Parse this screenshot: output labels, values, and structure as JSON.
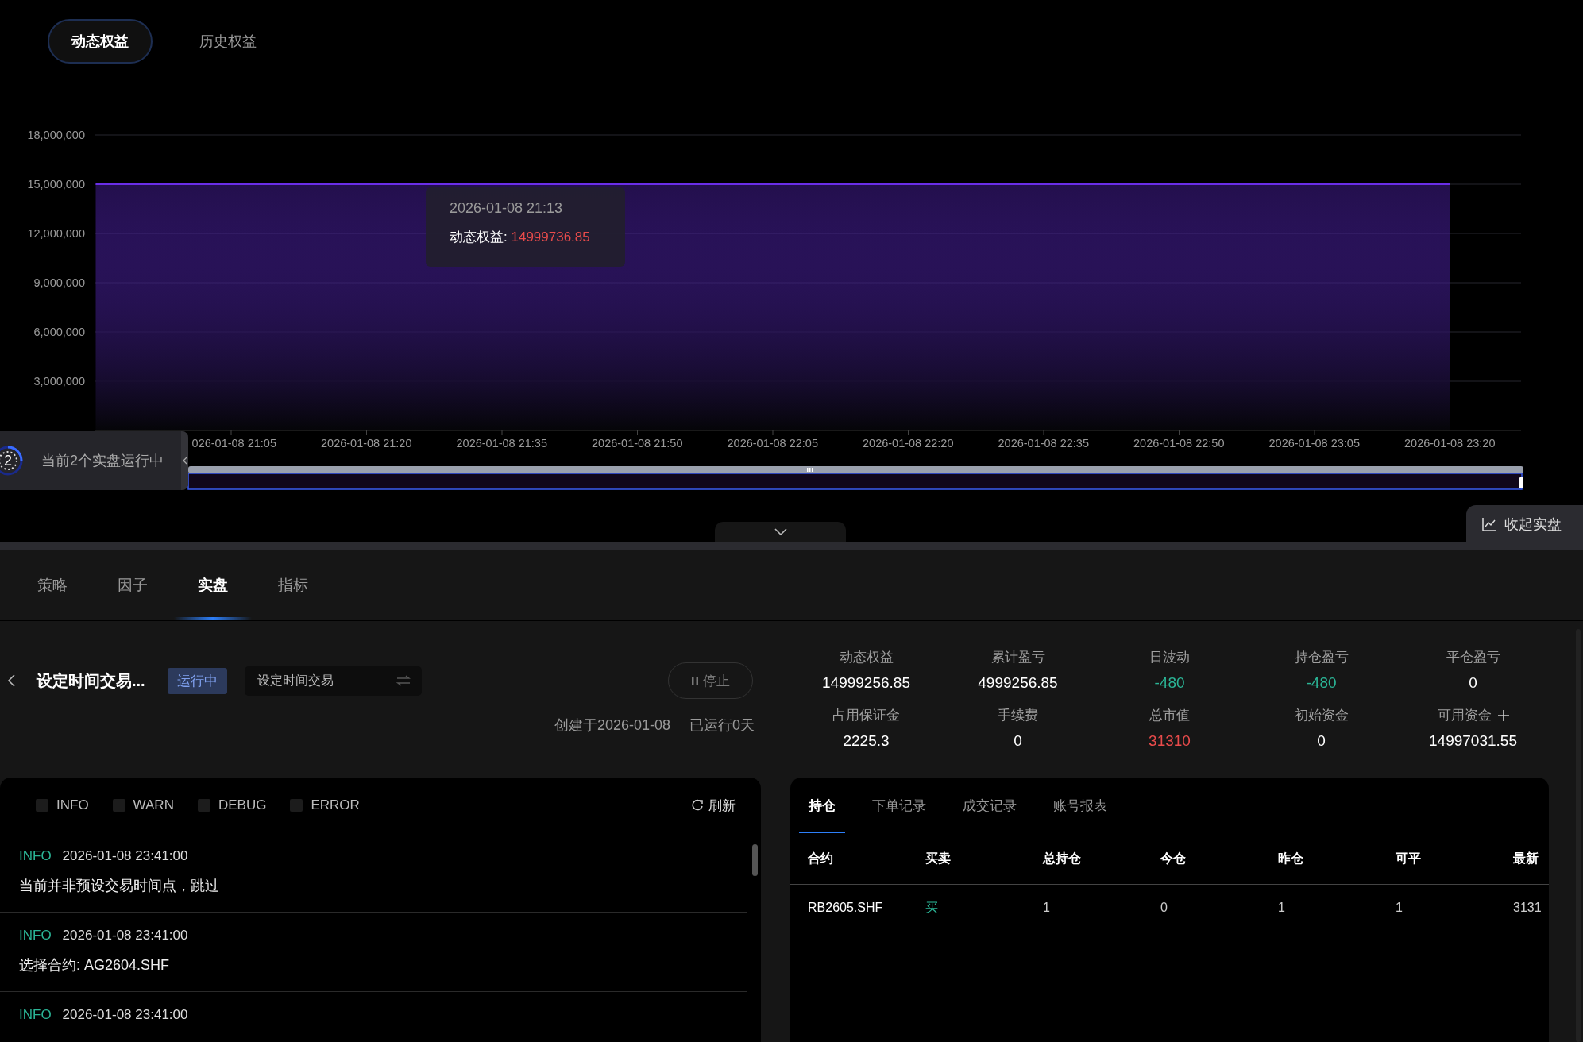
{
  "equity_tabs": [
    {
      "label": "动态权益",
      "selected": true
    },
    {
      "label": "历史权益",
      "selected": false
    }
  ],
  "equity_chart": {
    "chart_data": {
      "type": "area",
      "grid": true,
      "categories": [
        null,
        "026-01-08 21:05",
        "2026-01-08 21:20",
        "2026-01-08 21:35",
        "2026-01-08 21:50",
        "2026-01-08 22:05",
        "2026-01-08 22:20",
        "2026-01-08 22:35",
        "2026-01-08 22:50",
        "2026-01-08 23:05",
        "2026-01-08 23:20"
      ],
      "series": [
        {
          "color": "#6a2ee8",
          "values": [
            15000000,
            15000000,
            15000000,
            15000000,
            15000000,
            15000000,
            15000000,
            15000000,
            15000000,
            15000000,
            15000000
          ]
        }
      ],
      "ylim": [
        0,
        18000000
      ],
      "yticks": [
        {
          "value": 3000000,
          "label": "3,000,000"
        },
        {
          "value": 6000000,
          "label": "6,000,000"
        },
        {
          "value": 9000000,
          "label": "9,000,000"
        },
        {
          "value": 12000000,
          "label": "12,000,000"
        },
        {
          "value": 15000000,
          "label": "15,000,000"
        },
        {
          "value": 18000000,
          "label": "18,000,000"
        }
      ]
    },
    "tooltip": {
      "time": "2026-01-08 21:13",
      "label": "动态权益:",
      "value": "14999736.85"
    }
  },
  "running_notice": {
    "count": "2",
    "text": "当前2个实盘运行中"
  },
  "collapse_button": {
    "label": "收起实盘"
  },
  "module_tabs": [
    {
      "label": "策略",
      "selected": false
    },
    {
      "label": "因子",
      "selected": false
    },
    {
      "label": "实盘",
      "selected": true
    },
    {
      "label": "指标",
      "selected": false
    }
  ],
  "strategy": {
    "title": "设定时间交易...",
    "status": "运行中",
    "selector": "设定时间交易",
    "stop_button": "停止",
    "created": "创建于2026-01-08",
    "running_days": "已运行0天"
  },
  "stats": [
    {
      "label": "动态权益",
      "value": "14999256.85",
      "color": "#ffffff",
      "addable": false
    },
    {
      "label": "累计盈亏",
      "value": "4999256.85",
      "color": "#ffffff",
      "addable": false
    },
    {
      "label": "日波动",
      "value": "-480",
      "color": "#2bb596",
      "addable": false
    },
    {
      "label": "持仓盈亏",
      "value": "-480",
      "color": "#2bb596",
      "addable": false
    },
    {
      "label": "平仓盈亏",
      "value": "0",
      "color": "#ffffff",
      "addable": false
    },
    {
      "label": "占用保证金",
      "value": "2225.3",
      "color": "#ffffff",
      "addable": false
    },
    {
      "label": "手续费",
      "value": "0",
      "color": "#ffffff",
      "addable": false
    },
    {
      "label": "总市值",
      "value": "31310",
      "color": "#e84b4b",
      "addable": false
    },
    {
      "label": "初始资金",
      "value": "0",
      "color": "#ffffff",
      "addable": false
    },
    {
      "label": "可用资金",
      "value": "14997031.55",
      "color": "#ffffff",
      "addable": true
    }
  ],
  "log_filters": [
    {
      "label": "INFO",
      "checked": false
    },
    {
      "label": "WARN",
      "checked": false
    },
    {
      "label": "DEBUG",
      "checked": false
    },
    {
      "label": "ERROR",
      "checked": false
    }
  ],
  "refresh_button": "刷新",
  "logs": [
    {
      "level": "INFO",
      "color": "#2bb596",
      "time": "2026-01-08 23:41:00",
      "message": "当前并非预设交易时间点，跳过"
    },
    {
      "level": "INFO",
      "color": "#2bb596",
      "time": "2026-01-08 23:41:00",
      "message": "选择合约: AG2604.SHF"
    },
    {
      "level": "INFO",
      "color": "#2bb596",
      "time": "2026-01-08 23:41:00"
    }
  ],
  "position_tabs": [
    {
      "label": "持仓",
      "selected": true
    },
    {
      "label": "下单记录",
      "selected": false
    },
    {
      "label": "成交记录",
      "selected": false
    },
    {
      "label": "账号报表",
      "selected": false
    }
  ],
  "positions_table": {
    "columns": [
      "合约",
      "买卖",
      "总持仓",
      "今仓",
      "昨仓",
      "可平",
      "最新"
    ],
    "rows": [
      {
        "color": "#2bb596",
        "cells": [
          "RB2605.SHF",
          "买",
          "1",
          "0",
          "1",
          "1",
          "3131"
        ]
      }
    ]
  }
}
